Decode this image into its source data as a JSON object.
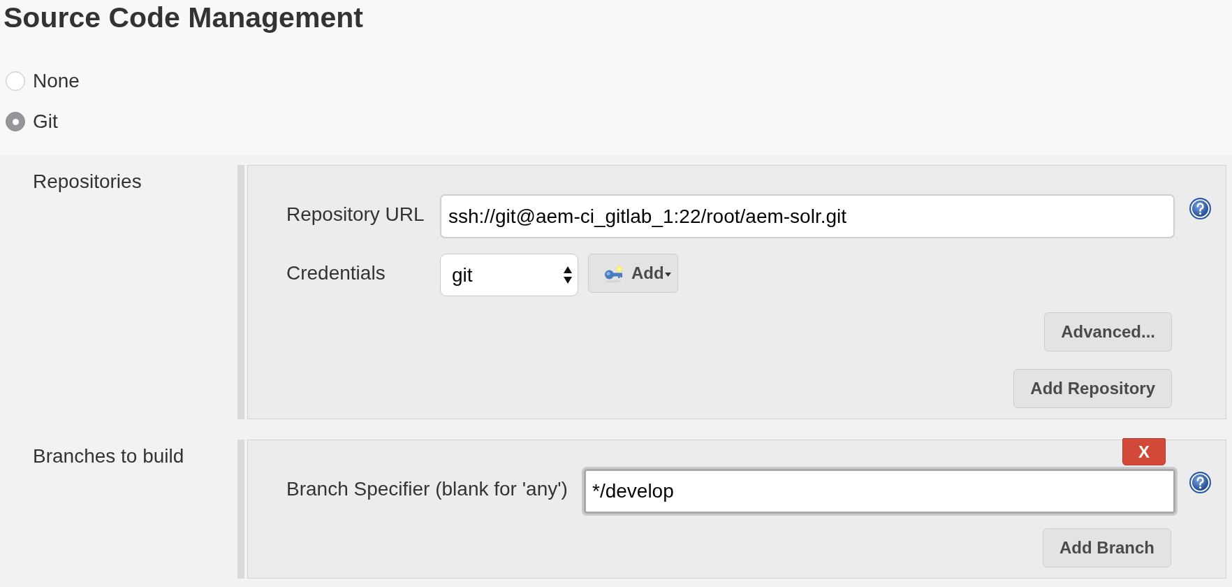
{
  "title": "Source Code Management",
  "scm_options": [
    {
      "label": "None",
      "selected": false
    },
    {
      "label": "Git",
      "selected": true
    }
  ],
  "repositories": {
    "label": "Repositories",
    "url": {
      "label": "Repository URL",
      "value": "ssh://git@aem-ci_gitlab_1:22/root/aem-solr.git"
    },
    "credentials": {
      "label": "Credentials",
      "value": "git",
      "add_button": "Add"
    },
    "buttons": [
      "Advanced...",
      "Add Repository"
    ]
  },
  "branches": {
    "label": "Branches to build",
    "delete_button": "X",
    "specifier": {
      "label": "Branch Specifier (blank for 'any')",
      "value": "*/develop",
      "focused": true
    },
    "buttons": [
      "Add Branch"
    ]
  }
}
